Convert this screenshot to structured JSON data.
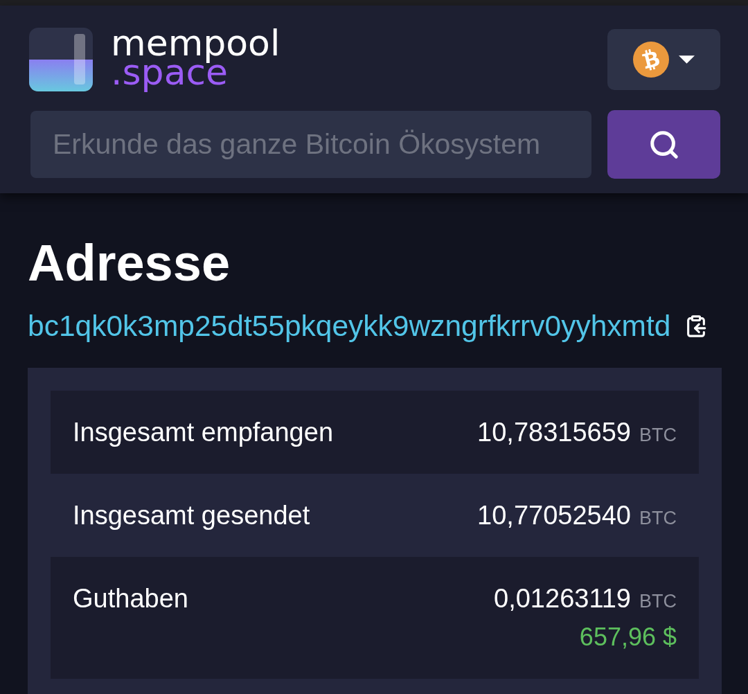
{
  "header": {
    "logo": {
      "name": "mempool",
      "suffix": ".space"
    },
    "search": {
      "placeholder": "Erkunde das ganze Bitcoin Ökosystem"
    }
  },
  "page": {
    "title": "Adresse",
    "address": "bc1qk0k3mp25dt55pkqeykk9wzngrfkrrv0yyhxmtd"
  },
  "summary": {
    "rows": [
      {
        "label": "Insgesamt empfangen",
        "value": "10,78315659",
        "unit": "BTC"
      },
      {
        "label": "Insgesamt gesendet",
        "value": "10,77052540",
        "unit": "BTC"
      },
      {
        "label": "Guthaben",
        "value": "0,01263119",
        "unit": "BTC",
        "fiat": "657,96 $"
      }
    ]
  }
}
